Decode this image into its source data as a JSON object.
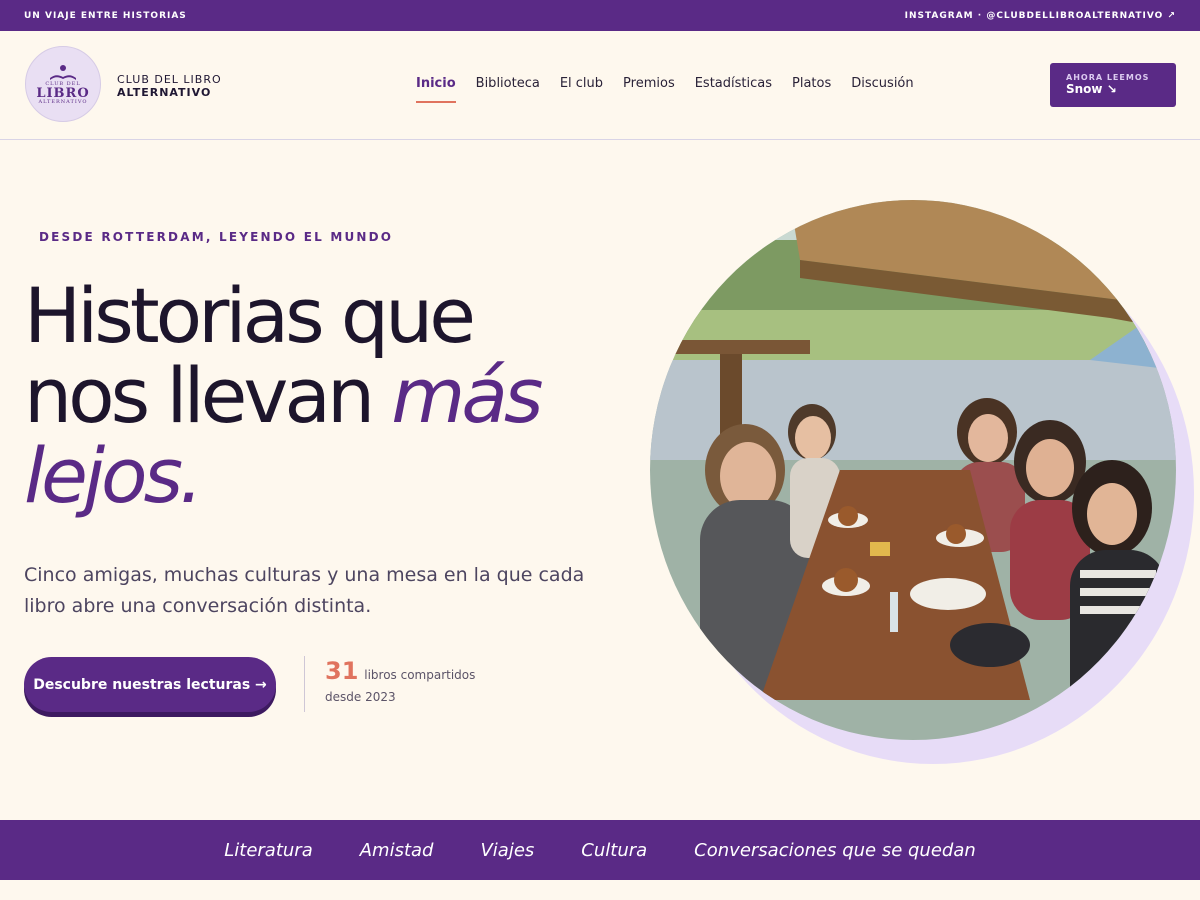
{
  "topbar": {
    "left": "UN VIAJE ENTRE HISTORIAS",
    "right": "INSTAGRAM · @CLUBDELLIBROALTERNATIVO ↗"
  },
  "logo": {
    "line1": "CLUB DEL",
    "line2": "LIBRO",
    "line3": "ALTERNATIVO"
  },
  "brand": {
    "line1": "CLUB DEL LIBRO",
    "line2": "ALTERNATIVO"
  },
  "nav": {
    "items": [
      "Inicio",
      "Biblioteca",
      "El club",
      "Premios",
      "Estadísticas",
      "Platos",
      "Discusión"
    ]
  },
  "now_reading": {
    "label": "AHORA LEEMOS",
    "title": "Snow ↘"
  },
  "hero": {
    "eyebrow": "DESDE ROTTERDAM, LEYENDO EL MUNDO",
    "title_part1": "Historias que",
    "title_part2": "nos llevan",
    "title_emphasis1": "más",
    "title_emphasis2": "lejos.",
    "lead": "Cinco amigas, muchas culturas y una mesa en la que cada libro abre una conversación distinta.",
    "cta": "Descubre nuestras lecturas →",
    "stat_number": "31",
    "stat_label": "libros compartidos",
    "stat_since": "desde 2023"
  },
  "band": {
    "items": [
      "Literatura",
      "Amistad",
      "Viajes",
      "Cultura",
      "Conversaciones que se quedan"
    ]
  },
  "colors": {
    "primary": "#5a2a86",
    "accent": "#e0735e",
    "background": "#fef8ee"
  }
}
